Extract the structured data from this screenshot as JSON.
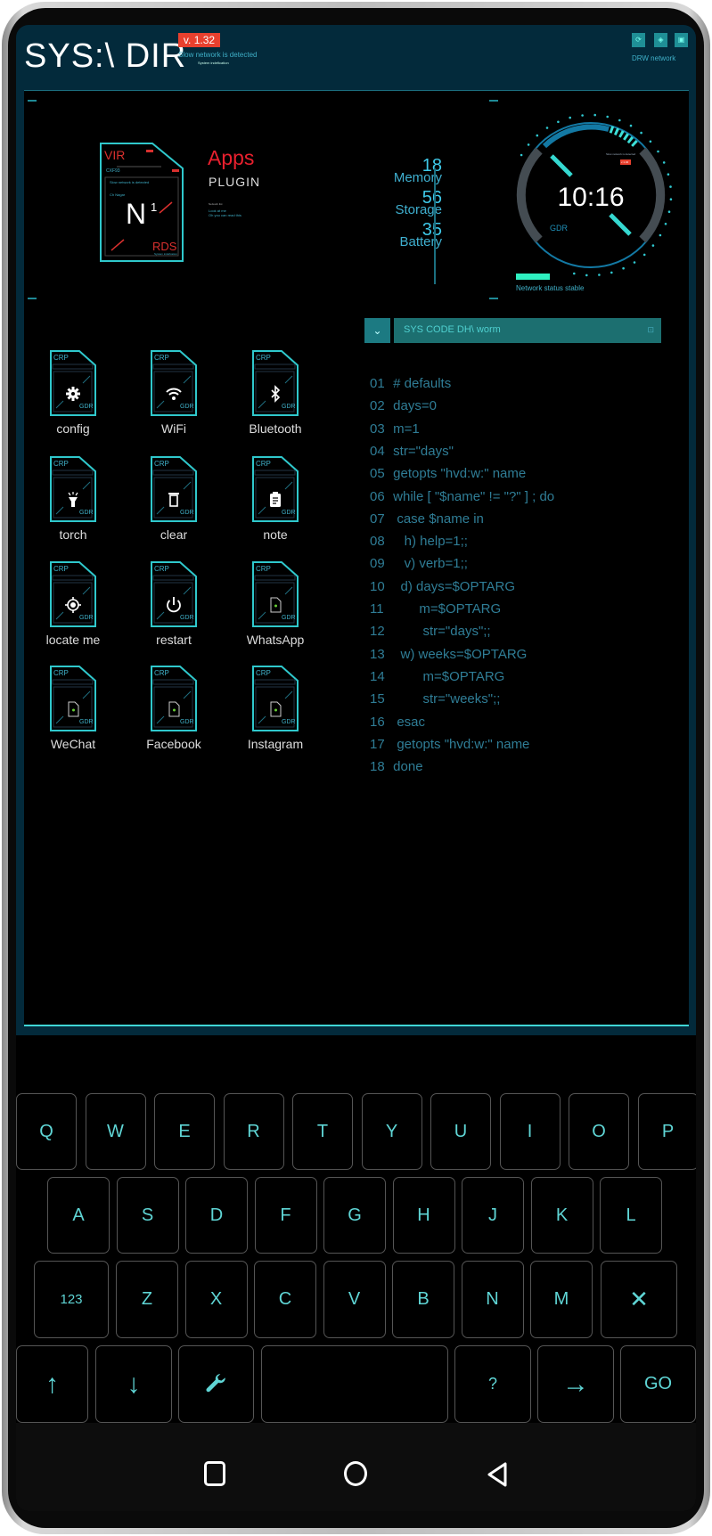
{
  "header": {
    "title": "SYS:\\ DIR",
    "version": "v. 1.32",
    "network_warning": "Slow network is detected",
    "system_info": "System indefication",
    "network_label": "DRW network",
    "icons": [
      "sync-icon",
      "network-icon",
      "screen-icon"
    ]
  },
  "card": {
    "top": "VIR",
    "field": "sec:ill",
    "code": "CXF93",
    "note": "Slow network is detected",
    "trigger": "Ch Nagar",
    "symbol": "N",
    "superscript": "1",
    "bottom": "RDS",
    "bottom_sub": "System indefication"
  },
  "plugin": {
    "title": "Apps",
    "subtitle": "PLUGIN",
    "tiny": "Network list",
    "line1": "Look at me",
    "line2": "Oh you can read this"
  },
  "stats": [
    {
      "value": "18",
      "label": "Memory"
    },
    {
      "value": "56",
      "label": "Storage"
    },
    {
      "value": "35",
      "label": "Battery"
    }
  ],
  "clock": {
    "time": "10:16",
    "label": "GDR",
    "sub": "System indefication",
    "alert": "Slow network is detected",
    "badge": "v 1.32"
  },
  "network": {
    "status": "Network status stable",
    "level": 1.0
  },
  "apps": [
    {
      "label": "config",
      "icon": "gear-icon"
    },
    {
      "label": "WiFi",
      "icon": "wifi-icon"
    },
    {
      "label": "Bluetooth",
      "icon": "bluetooth-icon"
    },
    {
      "label": "torch",
      "icon": "flashlight-icon"
    },
    {
      "label": "clear",
      "icon": "trash-icon"
    },
    {
      "label": "note",
      "icon": "clipboard-icon"
    },
    {
      "label": "locate me",
      "icon": "crosshair-icon"
    },
    {
      "label": "restart",
      "icon": "power-icon"
    },
    {
      "label": "WhatsApp",
      "icon": "file-icon"
    },
    {
      "label": "WeChat",
      "icon": "file-icon"
    },
    {
      "label": "Facebook",
      "icon": "file-icon"
    },
    {
      "label": "Instagram",
      "icon": "file-icon"
    }
  ],
  "app_card": {
    "top": "CRP",
    "bottom": "GDR"
  },
  "code": {
    "title": "SYS CODE DH\\ worm",
    "lines": [
      [
        "01",
        "# defaults"
      ],
      [
        "02",
        "days=0"
      ],
      [
        "03",
        "m=1"
      ],
      [
        "04",
        "str=\"days\""
      ],
      [
        "05",
        "getopts \"hvd:w:\" name"
      ],
      [
        "06",
        "while [ \"$name\" != \"?\" ] ; do"
      ],
      [
        "07",
        " case $name in"
      ],
      [
        "08",
        "   h) help=1;;"
      ],
      [
        "09",
        "   v) verb=1;;"
      ],
      [
        "10",
        "  d) days=$OPTARG"
      ],
      [
        "11",
        "       m=$OPTARG"
      ],
      [
        "12",
        "        str=\"days\";;"
      ],
      [
        "13",
        "  w) weeks=$OPTARG"
      ],
      [
        "14",
        "        m=$OPTARG"
      ],
      [
        "15",
        "        str=\"weeks\";;"
      ],
      [
        "16",
        " esac"
      ],
      [
        "17",
        " getopts \"hvd:w:\" name"
      ],
      [
        "18",
        "done"
      ]
    ]
  },
  "keyboard": {
    "row1": [
      "Q",
      "W",
      "E",
      "R",
      "T",
      "Y",
      "U",
      "I",
      "O",
      "P"
    ],
    "row2": [
      "A",
      "S",
      "D",
      "F",
      "G",
      "H",
      "J",
      "K",
      "L"
    ],
    "row3": [
      "123",
      "Z",
      "X",
      "C",
      "V",
      "B",
      "N",
      "M",
      "✕"
    ],
    "row4": [
      "↑",
      "↓",
      "🔧",
      "",
      "?",
      "→",
      "GO"
    ]
  },
  "colors": {
    "accent": "#3fd6d6",
    "header": "#032a3b",
    "badge": "#e8402e",
    "code": "#2f7d96"
  }
}
